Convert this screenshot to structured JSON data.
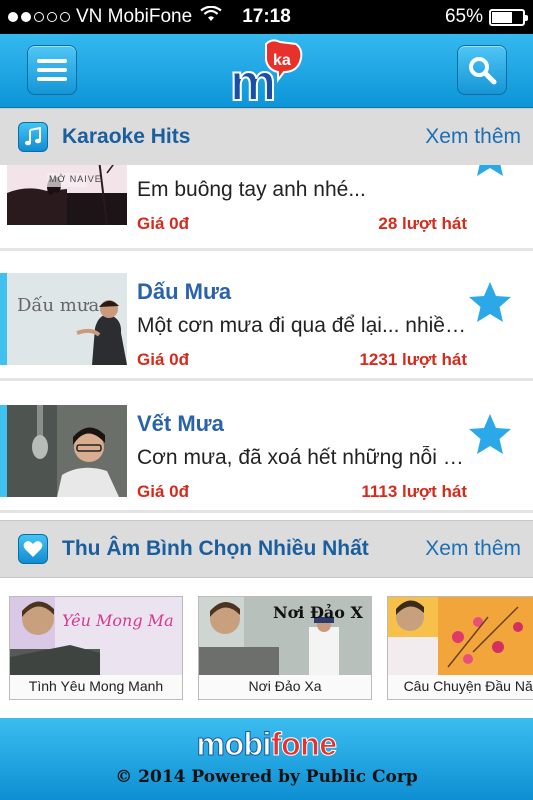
{
  "status_bar": {
    "carrier": "VN MobiFone",
    "time": "17:18",
    "battery": "65%",
    "battery_level": 0.65,
    "signal_bars_filled": 2,
    "signal_bars_total": 5
  },
  "header": {
    "menu_icon": "hamburger-menu-icon",
    "logo_text": "mka",
    "search_icon": "search-icon"
  },
  "karaoke_section": {
    "title": "Karaoke Hits",
    "see_more": "Xem thêm",
    "icon": "music-note-icon",
    "songs": [
      {
        "title": "",
        "desc": "Em buông tay anh nhé...",
        "price": "Giá 0đ",
        "count": "28 lượt hát",
        "thumb_text": "MỜ NAIVE"
      },
      {
        "title": "Dấu Mưa",
        "desc": "Một cơn mưa đi qua để lại... nhiều kỷ niệm",
        "price": "Giá 0đ",
        "count": "1231 lượt hát",
        "thumb_text": "Dấu mưa"
      },
      {
        "title": "Vết Mưa",
        "desc": "Cơn mưa, đã xoá hết những nỗi đau",
        "price": "Giá 0đ",
        "count": "1113 lượt hát",
        "thumb_text": ""
      }
    ]
  },
  "vote_section": {
    "title": "Thu Âm Bình Chọn Nhiều Nhất",
    "see_more": "Xem thêm",
    "icon": "heart-icon",
    "cards": [
      {
        "label": "Tình Yêu Mong Manh",
        "overlay": "Yêu Mong Ma"
      },
      {
        "label": "Nơi Đảo Xa",
        "overlay": "Nơi Đảo X"
      },
      {
        "label": "Câu Chuyện Đầu Năm",
        "overlay": ""
      }
    ]
  },
  "footer": {
    "brand_mobi": "mobi",
    "brand_fone": "fone",
    "copyright": "© 2014 Powered by Public Corp"
  },
  "colors": {
    "header_blue": "#1aa3e2",
    "price_red": "#d62b1c",
    "title_blue": "#2a62ab",
    "star_blue": "#2ba8e8"
  }
}
